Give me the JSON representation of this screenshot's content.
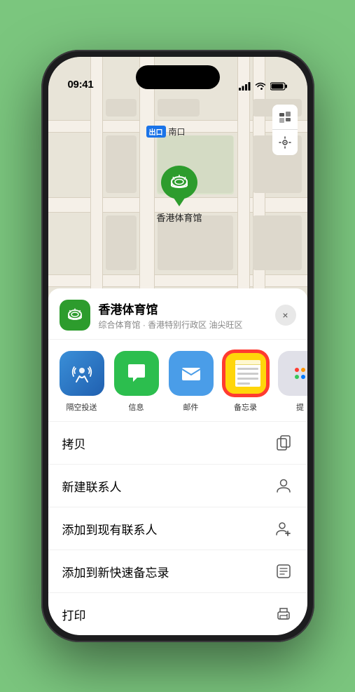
{
  "status": {
    "time": "09:41",
    "signal": "●●●●",
    "wifi": "WiFi",
    "battery": "Battery"
  },
  "map": {
    "label_badge": "出口",
    "label_text": "南口",
    "controls": {
      "map_icon": "🗺",
      "location_icon": "➤"
    },
    "stadium": {
      "name": "香港体育馆"
    }
  },
  "venue": {
    "name": "香港体育馆",
    "description": "综合体育馆 · 香港特别行政区 油尖旺区",
    "close_label": "×"
  },
  "share_items": [
    {
      "id": "airdrop",
      "label": "隔空投送",
      "type": "airdrop"
    },
    {
      "id": "message",
      "label": "信息",
      "type": "message"
    },
    {
      "id": "mail",
      "label": "邮件",
      "type": "mail"
    },
    {
      "id": "notes",
      "label": "备忘录",
      "type": "notes"
    },
    {
      "id": "more",
      "label": "提",
      "type": "more"
    }
  ],
  "actions": [
    {
      "id": "copy",
      "label": "拷贝",
      "icon": "copy"
    },
    {
      "id": "new-contact",
      "label": "新建联系人",
      "icon": "person"
    },
    {
      "id": "add-contact",
      "label": "添加到现有联系人",
      "icon": "person-add"
    },
    {
      "id": "quick-note",
      "label": "添加到新快速备忘录",
      "icon": "note"
    },
    {
      "id": "print",
      "label": "打印",
      "icon": "print"
    }
  ]
}
